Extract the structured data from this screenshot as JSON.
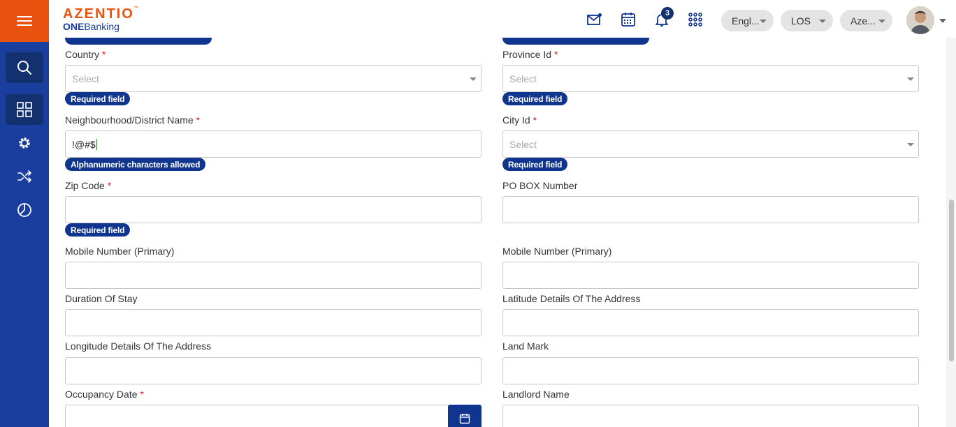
{
  "app": {
    "logo_brand": "AZENTIO",
    "logo_tm": "™",
    "logo_product_bold": "ONE",
    "logo_product": "Banking"
  },
  "header": {
    "notification_count": "3",
    "language_label": "Engl...",
    "module_label": "LOS",
    "entity_label": "Aze...",
    "icons": [
      "mail-icon",
      "calendar-icon",
      "bell-icon",
      "apps-grid-icon"
    ]
  },
  "sidebar": {
    "items": [
      "search-icon",
      "dashboard-icon",
      "settings-icon",
      "shuffle-icon",
      "pie-chart-icon"
    ]
  },
  "form": {
    "country": {
      "label": "Country",
      "required": "*",
      "placeholder": "Select",
      "error": "Required field"
    },
    "province_id": {
      "label": "Province Id",
      "required": "*",
      "placeholder": "Select",
      "error": "Required field"
    },
    "neighbourhood": {
      "label": "Neighbourhood/District Name",
      "required": "*",
      "value": "!@#$",
      "error": "Alphanumeric characters allowed"
    },
    "city_id": {
      "label": "City Id",
      "required": "*",
      "placeholder": "Select",
      "error": "Required field"
    },
    "zip_code": {
      "label": "Zip Code",
      "required": "*",
      "value": "",
      "error": "Required field"
    },
    "po_box": {
      "label": "PO BOX Number",
      "value": ""
    },
    "mobile_primary_left": {
      "label": "Mobile Number (Primary)",
      "value": ""
    },
    "mobile_primary_right": {
      "label": "Mobile Number (Primary)",
      "value": ""
    },
    "duration_of_stay": {
      "label": "Duration Of Stay",
      "value": ""
    },
    "latitude": {
      "label": "Latitude Details Of The Address",
      "value": ""
    },
    "longitude": {
      "label": "Longitude Details Of The Address",
      "value": ""
    },
    "land_mark": {
      "label": "Land Mark",
      "value": ""
    },
    "occupancy_date": {
      "label": "Occupancy Date",
      "required": "*",
      "value": ""
    },
    "landlord_name": {
      "label": "Landlord Name",
      "value": ""
    }
  },
  "colors": {
    "brand_orange": "#e8540f",
    "sidebar_blue": "#1a3e9e",
    "chip_blue": "#10358f",
    "required_red": "#e02020"
  }
}
